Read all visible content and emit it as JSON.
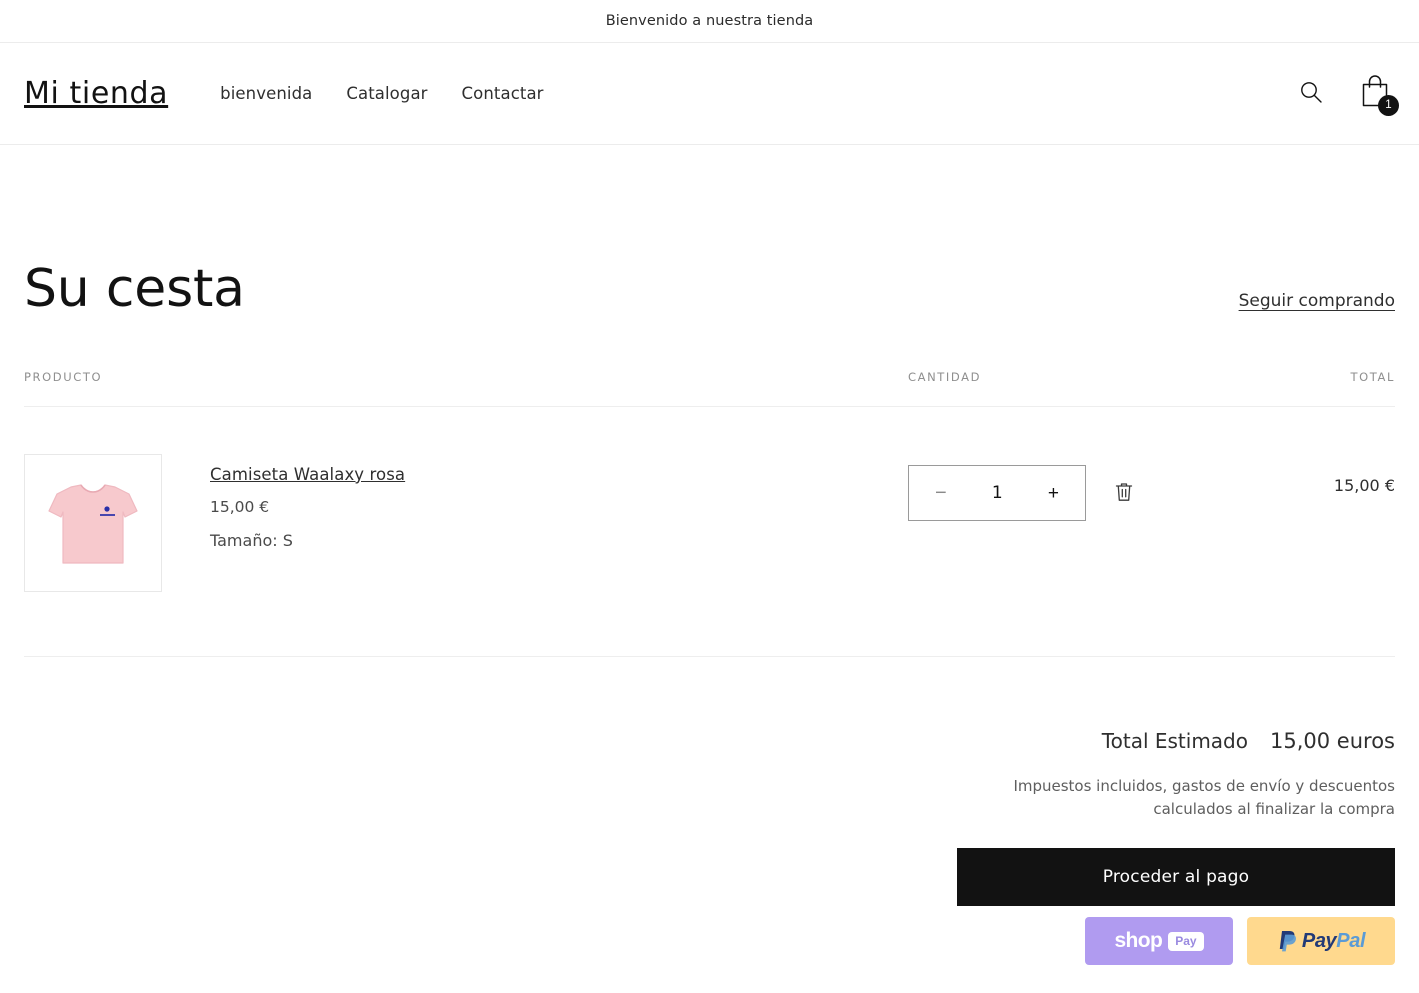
{
  "announcement": {
    "text": "Bienvenido a nuestra tienda"
  },
  "header": {
    "brand": "Mi tienda",
    "nav": [
      {
        "label": "bienvenida"
      },
      {
        "label": "Catalogar"
      },
      {
        "label": "Contactar"
      }
    ],
    "search_icon": "search-icon",
    "cart_icon": "shopping-bag-icon",
    "cart_count": "1"
  },
  "cart": {
    "title": "Su cesta",
    "continue_link": "Seguir comprando",
    "columns": {
      "product": "PRODUCTO",
      "quantity": "CANTIDAD",
      "total": "TOTAL"
    },
    "items": [
      {
        "title": "Camiseta Waalaxy rosa",
        "price": "15,00 €",
        "variant": "Tamaño: S",
        "quantity": "1",
        "line_total": "15,00 €",
        "decrease_label": "−",
        "increase_label": "+",
        "remove_icon": "trash-icon",
        "image_alt": "Camiseta rosa"
      }
    ]
  },
  "summary": {
    "total_label": "Total Estimado",
    "total_value": "15,00 euros",
    "note": "Impuestos incluidos, gastos de envío y descuentos calculados al finalizar la compra",
    "checkout_label": "Proceder al pago",
    "wallets": [
      {
        "name": "shop-pay",
        "word": "shop",
        "pill": "Pay"
      },
      {
        "name": "paypal",
        "first": "Pay",
        "second": "Pal"
      }
    ]
  },
  "colors": {
    "accent_dark": "#121212",
    "shop_pay_bg": "#b09bf0",
    "paypal_bg": "#ffd98e",
    "border": "#ececec",
    "muted_text": "#8f8f8f"
  }
}
